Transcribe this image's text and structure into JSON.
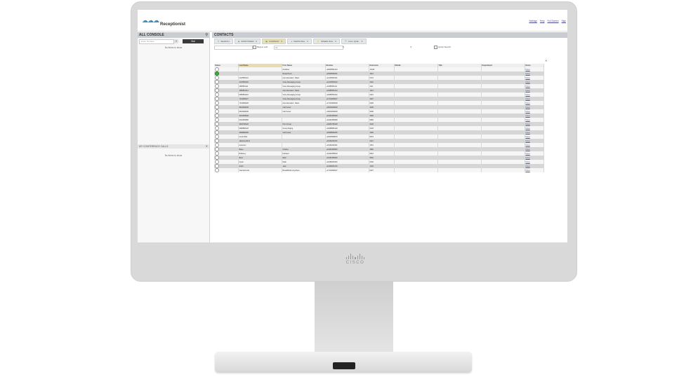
{
  "app": {
    "title": "Receptionist",
    "logo_icon": "cloud-people-logo-icon",
    "top_links": [
      "Settings",
      "Help",
      "Full Screen",
      "Sign"
    ],
    "brand": "CISCO"
  },
  "left": {
    "all_console": {
      "title": "ALL CONSOLE",
      "dial_placeholder": "Enter Number",
      "dial_button": "Dial",
      "empty": "No items to show"
    },
    "conference": {
      "title": "MY CONFERENCE CALLS",
      "empty": "No items to show"
    }
  },
  "main": {
    "title": "CONTACTS",
    "tabs": [
      {
        "label": "SEARCH",
        "icon": "magnifier-icon",
        "active": false
      },
      {
        "label": "MONITORED",
        "icon": "eye-icon",
        "active": false
      },
      {
        "label": "COMPANY",
        "icon": "building-icon",
        "active": true
      },
      {
        "label": "PERSONAL",
        "icon": "person-icon",
        "active": false
      },
      {
        "label": "SPEED DIAL",
        "icon": "lightning-icon",
        "active": false
      },
      {
        "label": "CALL QUE..",
        "icon": "queue-icon",
        "active": false
      }
    ],
    "filter": {
      "begins_with": "Begins with",
      "all": "All",
      "quick_search": "Quick Search"
    },
    "columns": [
      "Status",
      "Last Name",
      "First Name",
      "Number",
      "Extension",
      "Mobile",
      "Title",
      "Department",
      "Notes"
    ],
    "rows": [
      [
        "none",
        "",
        "ZooMeet",
        "+18005551234",
        "12345",
        "",
        "",
        "",
        "Notes"
      ],
      [
        "available",
        "",
        "Break Room",
        "+16505550001",
        "3001",
        "",
        "",
        "",
        "Notes"
      ],
      [
        "none",
        "2125550101",
        "Auto Attendant - Basic",
        "+12125550101",
        "0101",
        "",
        "",
        "",
        "Notes"
      ],
      [
        "none",
        "2145550202",
        "Voice Messaging Group",
        "+12145550202",
        "0202",
        "",
        "",
        "",
        "Notes"
      ],
      [
        "none",
        "4085551111",
        "Voice Messaging Group",
        "+14085551111",
        "1111",
        "",
        "",
        "",
        "Notes"
      ],
      [
        "none",
        "4085551212",
        "Auto Attendant - Basic",
        "+14085551212",
        "1212",
        "",
        "",
        "",
        "Notes"
      ],
      [
        "none",
        "5085552222",
        "Voice Messaging Group",
        "+15085552222",
        "2222",
        "",
        "",
        "",
        "Notes"
      ],
      [
        "none",
        "7134050027",
        "Voice Messaging Group",
        "+17134050027",
        "0027",
        "",
        "",
        "",
        "Notes"
      ],
      [
        "none",
        "7134050028",
        "Auto Attendant - Basic",
        "+17134050028",
        "0028",
        "",
        "",
        "",
        "Notes"
      ],
      [
        "none",
        "8004009048",
        "Call Center",
        "+18004009048",
        "9048",
        "",
        "",
        "",
        "Notes"
      ],
      [
        "none",
        "8004009038",
        "Call Center",
        "+18004009038",
        "9038",
        "",
        "",
        "",
        "Notes"
      ],
      [
        "none",
        "9152365938",
        "",
        "+19152365938",
        "5938",
        "",
        "",
        "",
        "Notes"
      ],
      [
        "none",
        "9152365958",
        "",
        "+19152365958",
        "5958",
        "",
        "",
        "",
        "Notes"
      ],
      [
        "none",
        "9083798128",
        "Hunt Group",
        "+19083798128",
        "8128",
        "",
        "",
        "",
        "Notes"
      ],
      [
        "none",
        "9088886128",
        "Group Paging",
        "+19088886128",
        "6128",
        "",
        "",
        "",
        "Notes"
      ],
      [
        "none",
        "9088886285",
        "Call Center",
        "+19088886285",
        "6285",
        "",
        "",
        "",
        "Notes"
      ],
      [
        "none",
        "Arnold Bell",
        "",
        "+19035558678",
        "8678",
        "",
        "",
        "",
        "Notes"
      ],
      [
        "none",
        "Jakobsen6113",
        "",
        "+19152206113",
        "6113",
        "",
        "",
        "",
        "Notes"
      ],
      [
        "none",
        "anderson",
        "",
        "+19152201501",
        "1501",
        "",
        "",
        "",
        "Notes"
      ],
      [
        "none",
        "Bales",
        "Charles",
        "+19152365950",
        "5950",
        "",
        "",
        "",
        "Notes"
      ],
      [
        "none",
        "Brillamey",
        "Kathleen",
        "+19152365518",
        "5518",
        "",
        "",
        "",
        "Notes"
      ],
      [
        "none",
        "Blom",
        "Barb",
        "+19152365530",
        "5530",
        "",
        "",
        "",
        "Notes"
      ],
      [
        "none",
        "Gavin",
        "Mark",
        "+19186050336",
        "0336",
        "",
        "",
        "",
        "Notes"
      ],
      [
        "none",
        "Smith",
        "Jack",
        "+19186051236",
        "1236",
        "",
        "",
        "",
        "Notes"
      ],
      [
        "none",
        "TeamZoom01",
        "BroadWorks Anywhere",
        "+17134050027",
        "0027",
        "",
        "",
        "",
        "Notes"
      ]
    ]
  }
}
